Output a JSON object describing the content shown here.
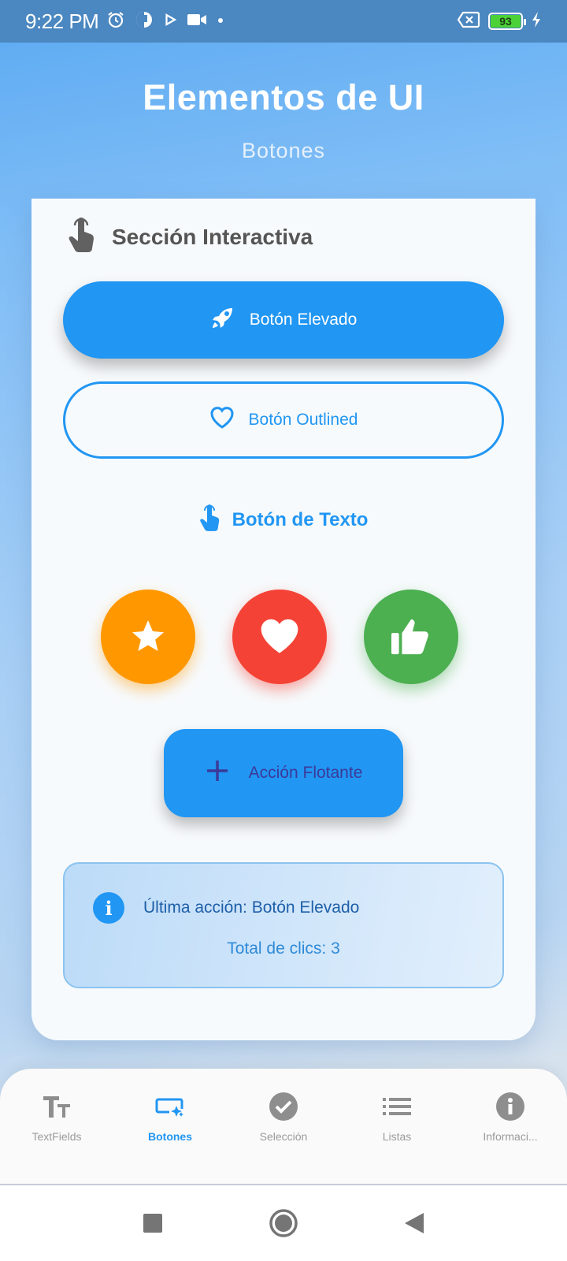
{
  "status_bar": {
    "time": "9:22 PM",
    "battery_level": "93",
    "icons": [
      "alarm-icon",
      "app-icon",
      "play-icon",
      "video-icon",
      "dot-icon",
      "sim-icon",
      "battery-icon",
      "charging-icon"
    ]
  },
  "header": {
    "title": "Elementos de UI",
    "subtitle": "Botones"
  },
  "card": {
    "section_title": "Sección Interactiva",
    "section_icon": "touch-icon",
    "elevated_button": {
      "label": "Botón Elevado",
      "icon": "rocket-icon"
    },
    "outlined_button": {
      "label": "Botón Outlined",
      "icon": "heart-outline-icon"
    },
    "text_button": {
      "label": "Botón de Texto",
      "icon": "touch-icon"
    },
    "circle_buttons": [
      {
        "icon": "star-icon",
        "color": "#ff9800"
      },
      {
        "icon": "heart-icon",
        "color": "#f44336"
      },
      {
        "icon": "thumb-up-icon",
        "color": "#4caf50"
      }
    ],
    "fab": {
      "label": "Acción Flotante",
      "icon": "plus-icon"
    },
    "info": {
      "last_action": "Última acción: Botón Elevado",
      "total_clicks": "Total de clics: 3"
    }
  },
  "bottom_nav": {
    "items": [
      {
        "label": "TextFields",
        "icon": "text-fields-icon",
        "active": false
      },
      {
        "label": "Botones",
        "icon": "smart-button-icon",
        "active": true
      },
      {
        "label": "Selección",
        "icon": "check-circle-icon",
        "active": false
      },
      {
        "label": "Listas",
        "icon": "list-icon",
        "active": false
      },
      {
        "label": "Informaci...",
        "icon": "info-icon",
        "active": false
      }
    ]
  },
  "colors": {
    "primary": "#2196f3",
    "orange": "#ff9800",
    "red": "#f44336",
    "green": "#4caf50"
  }
}
